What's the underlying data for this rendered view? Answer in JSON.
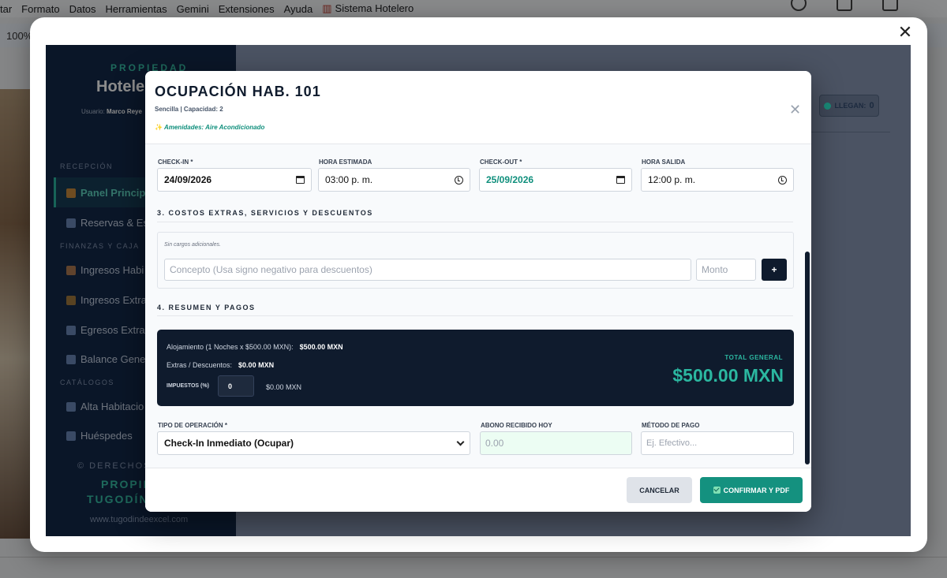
{
  "background": {
    "menu": [
      "tar",
      "Formato",
      "Datos",
      "Herramientas",
      "Gemini",
      "Extensiones",
      "Ayuda",
      "Sistema Hotelero"
    ],
    "zoom": "100%"
  },
  "sidebar": {
    "property_label": "PROPIEDAD",
    "property_name": "Hotele",
    "user_label": "Usuario:",
    "user_name": "Marco Reye",
    "section_recepcion": "RECEPCIÓN",
    "section_finanzas": "FINANZAS Y CAJA",
    "section_catalogos": "CATÁLOGOS",
    "items": [
      {
        "label": "Panel Princip"
      },
      {
        "label": "Reservas & Es"
      },
      {
        "label": "Ingresos Habi"
      },
      {
        "label": "Ingresos Extra"
      },
      {
        "label": "Egresos Extras"
      },
      {
        "label": "Balance Gener"
      },
      {
        "label": "Alta Habitacio"
      },
      {
        "label": "Huéspedes"
      }
    ],
    "footer_rights": "© DERECHOS",
    "footer_brand1": "PROPIED",
    "footer_brand2": "TUGODÍN",
    "footer_url": "www.tugodindeexcel.com"
  },
  "main": {
    "badge_label": "LLEGAN:",
    "badge_count": "0"
  },
  "modal": {
    "title": "OCUPACIÓN HAB. 101",
    "subtitle": "Sencilla | Capacidad: 2",
    "amenities": "Amenidades: Aire Acondicionado",
    "checkin_label": "CHECK-IN *",
    "checkin_value": "24/09/2026",
    "hora_estimada_label": "HORA ESTIMADA",
    "hora_estimada_value": "03:00 p. m.",
    "checkout_label": "CHECK-OUT *",
    "checkout_value": "25/09/2026",
    "hora_salida_label": "HORA SALIDA",
    "hora_salida_value": "12:00 p. m.",
    "section3_title": "3. COSTOS EXTRAS, SERVICIOS Y DESCUENTOS",
    "extras_empty": "Sin cargos adicionales.",
    "concepto_placeholder": "Concepto (Usa signo negativo para descuentos)",
    "monto_placeholder": "Monto",
    "add_label": "+",
    "section4_title": "4. RESUMEN Y PAGOS",
    "summary": {
      "alojamiento_label": "Alojamiento (1 Noches x $500.00 MXN):",
      "alojamiento_value": "$500.00 MXN",
      "extras_label": "Extras / Descuentos:",
      "extras_value": "$0.00 MXN",
      "impuestos_label": "IMPUESTOS (%)",
      "impuestos_value": "0",
      "impuestos_amount": "$0.00 MXN",
      "total_label": "TOTAL GENERAL",
      "total_value": "$500.00 MXN"
    },
    "tipo_label": "TIPO DE OPERACIÓN *",
    "tipo_value": "Check-In Inmediato (Ocupar)",
    "abono_label": "ABONO RECIBIDO HOY",
    "abono_placeholder": "0.00",
    "metodo_label": "MÉTODO DE PAGO",
    "metodo_placeholder": "Ej. Efectivo...",
    "cancel_label": "CANCELAR",
    "confirm_label": "CONFIRMAR Y PDF"
  },
  "colors": {
    "navy": "#0f1b2d",
    "teal": "#14917f",
    "accent_total": "#2bb7a0"
  }
}
